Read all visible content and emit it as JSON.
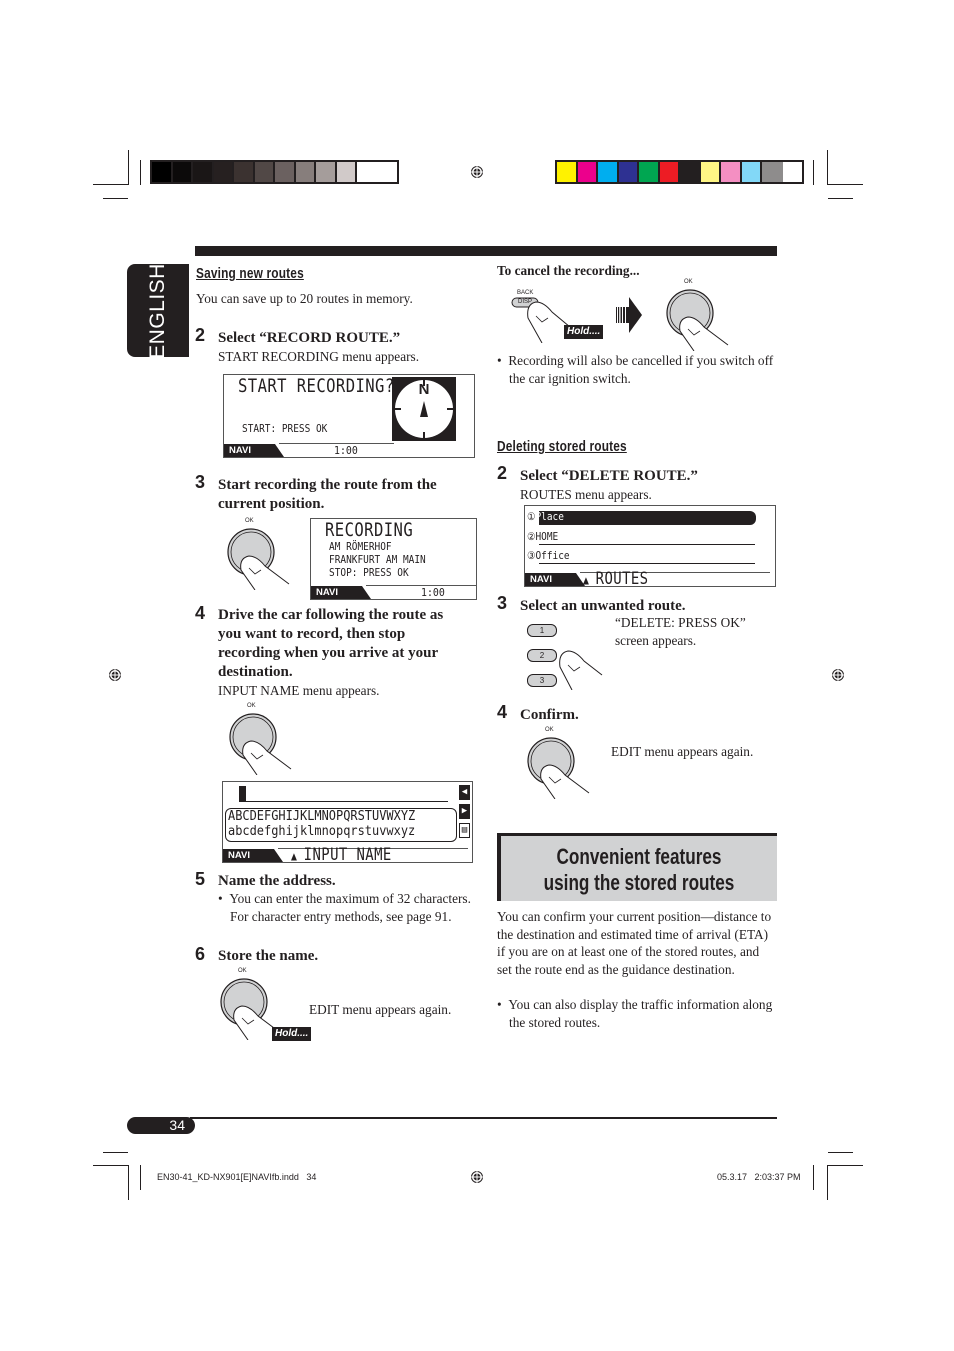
{
  "color_bars": {
    "grayscale": [
      "#000000",
      "#0c0a0a",
      "#1a1616",
      "#262020",
      "#3b3230",
      "#514846",
      "#6b6160",
      "#877e7c",
      "#a59d9b",
      "#d1cac9",
      "#ffffff"
    ],
    "process": [
      "#fff200",
      "#ec008c",
      "#00aeef",
      "#2e3192",
      "#00a651",
      "#ed1c24",
      "#231f20",
      "#fff685",
      "#f48fc2",
      "#82d8f7",
      "#8e8c8c"
    ]
  },
  "sidebar": {
    "language_tab": "ENGLISH"
  },
  "left": {
    "section_title": "Saving new routes",
    "intro": "You can save up to 20 routes in memory.",
    "steps": [
      {
        "num": "2",
        "title": "Select “RECORD ROUTE.”",
        "note": "START RECORDING menu appears."
      },
      {
        "num": "3",
        "title": "Start recording the route from the current position."
      },
      {
        "num": "4",
        "title": "Drive the car following the route as you want to record, then stop recording when you arrive at your destination.",
        "note": "INPUT NAME menu appears."
      },
      {
        "num": "5",
        "title": "Name the address.",
        "bullet": "You can enter the maximum of 32 characters. For character entry methods, see page 91."
      },
      {
        "num": "6",
        "title": "Store the name.",
        "note": "EDIT menu appears again."
      }
    ],
    "screen_start": {
      "title": "START RECORDING?",
      "prompt": "START: PRESS OK",
      "navi": "NAVI",
      "time": "1:00",
      "compass_label": "N"
    },
    "screen_recording": {
      "title": "RECORDING",
      "line1": "AM RÖMERHOF",
      "line2": "FRANKFURT AM MAIN",
      "line3": "STOP: PRESS OK",
      "navi": "NAVI",
      "time": "1:00"
    },
    "screen_input": {
      "upper": "ABCDEFGHIJKLMNOPQRSTUVWXYZ",
      "lower": "abcdefghijklmnopqrstuvwxyz",
      "navi": "NAVI",
      "title": "INPUT NAME"
    },
    "ok_label": "OK",
    "hold_label": "Hold...."
  },
  "right": {
    "cancel_title": "To cancel the recording...",
    "back_label": "BACK",
    "dsp_label": "DISP",
    "ok_label": "OK",
    "hold_label": "Hold....",
    "cancel_bullet": "Recording will also be cancelled if you switch off the car ignition switch.",
    "delete_title": "Deleting stored routes",
    "steps": [
      {
        "num": "2",
        "title": "Select “DELETE ROUTE.”",
        "note": "ROUTES menu appears."
      },
      {
        "num": "3",
        "title": "Select an unwanted route.",
        "note": "“DELETE: PRESS OK” screen appears."
      },
      {
        "num": "4",
        "title": "Confirm.",
        "note": "EDIT menu appears again."
      }
    ],
    "screen_routes": {
      "items": [
        {
          "n": "①",
          "label": "Place"
        },
        {
          "n": "②",
          "label": "HOME"
        },
        {
          "n": "③",
          "label": "Office"
        }
      ],
      "navi": "NAVI",
      "title": "ROUTES"
    },
    "preset_buttons": [
      "1",
      "2",
      "3"
    ],
    "banner": "Convenient features using the stored routes",
    "feature_text": "You can confirm your current position—distance to the destination and estimated time of arrival (ETA) if you are on at least one of the stored routes, and set the route end as the guidance destination.",
    "feature_bullet": "You can also display the traffic information along the stored routes."
  },
  "footer": {
    "page_number": "34",
    "file_slug": "EN30-41_KD-NX901[E]NAVIfb.indd   34",
    "timestamp": "05.3.17   2:03:37 PM"
  }
}
